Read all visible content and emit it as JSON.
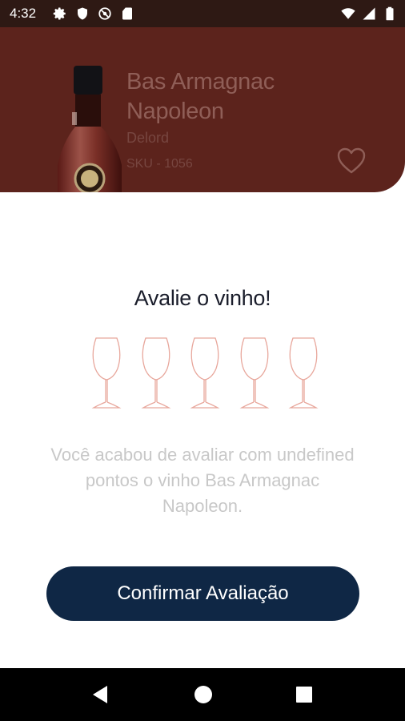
{
  "status_bar": {
    "time": "4:32",
    "left_icons": [
      "gear-icon",
      "shield-icon",
      "no-signal-icon",
      "sd-card-icon"
    ],
    "right_icons": [
      "wifi-icon",
      "signal-icon",
      "battery-icon"
    ]
  },
  "product": {
    "name": "Bas Armagnac Napoleon",
    "producer": "Delord",
    "sku": "SKU - 1056",
    "favorite_icon": "heart-icon"
  },
  "rating_sheet": {
    "title": "Avalie o vinho!",
    "glass_icons": [
      "wine-glass-icon",
      "wine-glass-icon",
      "wine-glass-icon",
      "wine-glass-icon",
      "wine-glass-icon"
    ],
    "rating_selected": 0,
    "rating_max": 5,
    "message": "Você acabou de avaliar com undefined pontos o vinho Bas Armagnac Napoleon.",
    "confirm_label": "Confirmar Avaliação"
  },
  "nav_bar": {
    "buttons": [
      "back-icon",
      "home-icon",
      "recents-icon"
    ]
  },
  "colors": {
    "header_bg": "#5c231c",
    "button_bg": "#0f2745",
    "glass_outline": "#e8a79c",
    "message_text": "#c8c8c8"
  }
}
